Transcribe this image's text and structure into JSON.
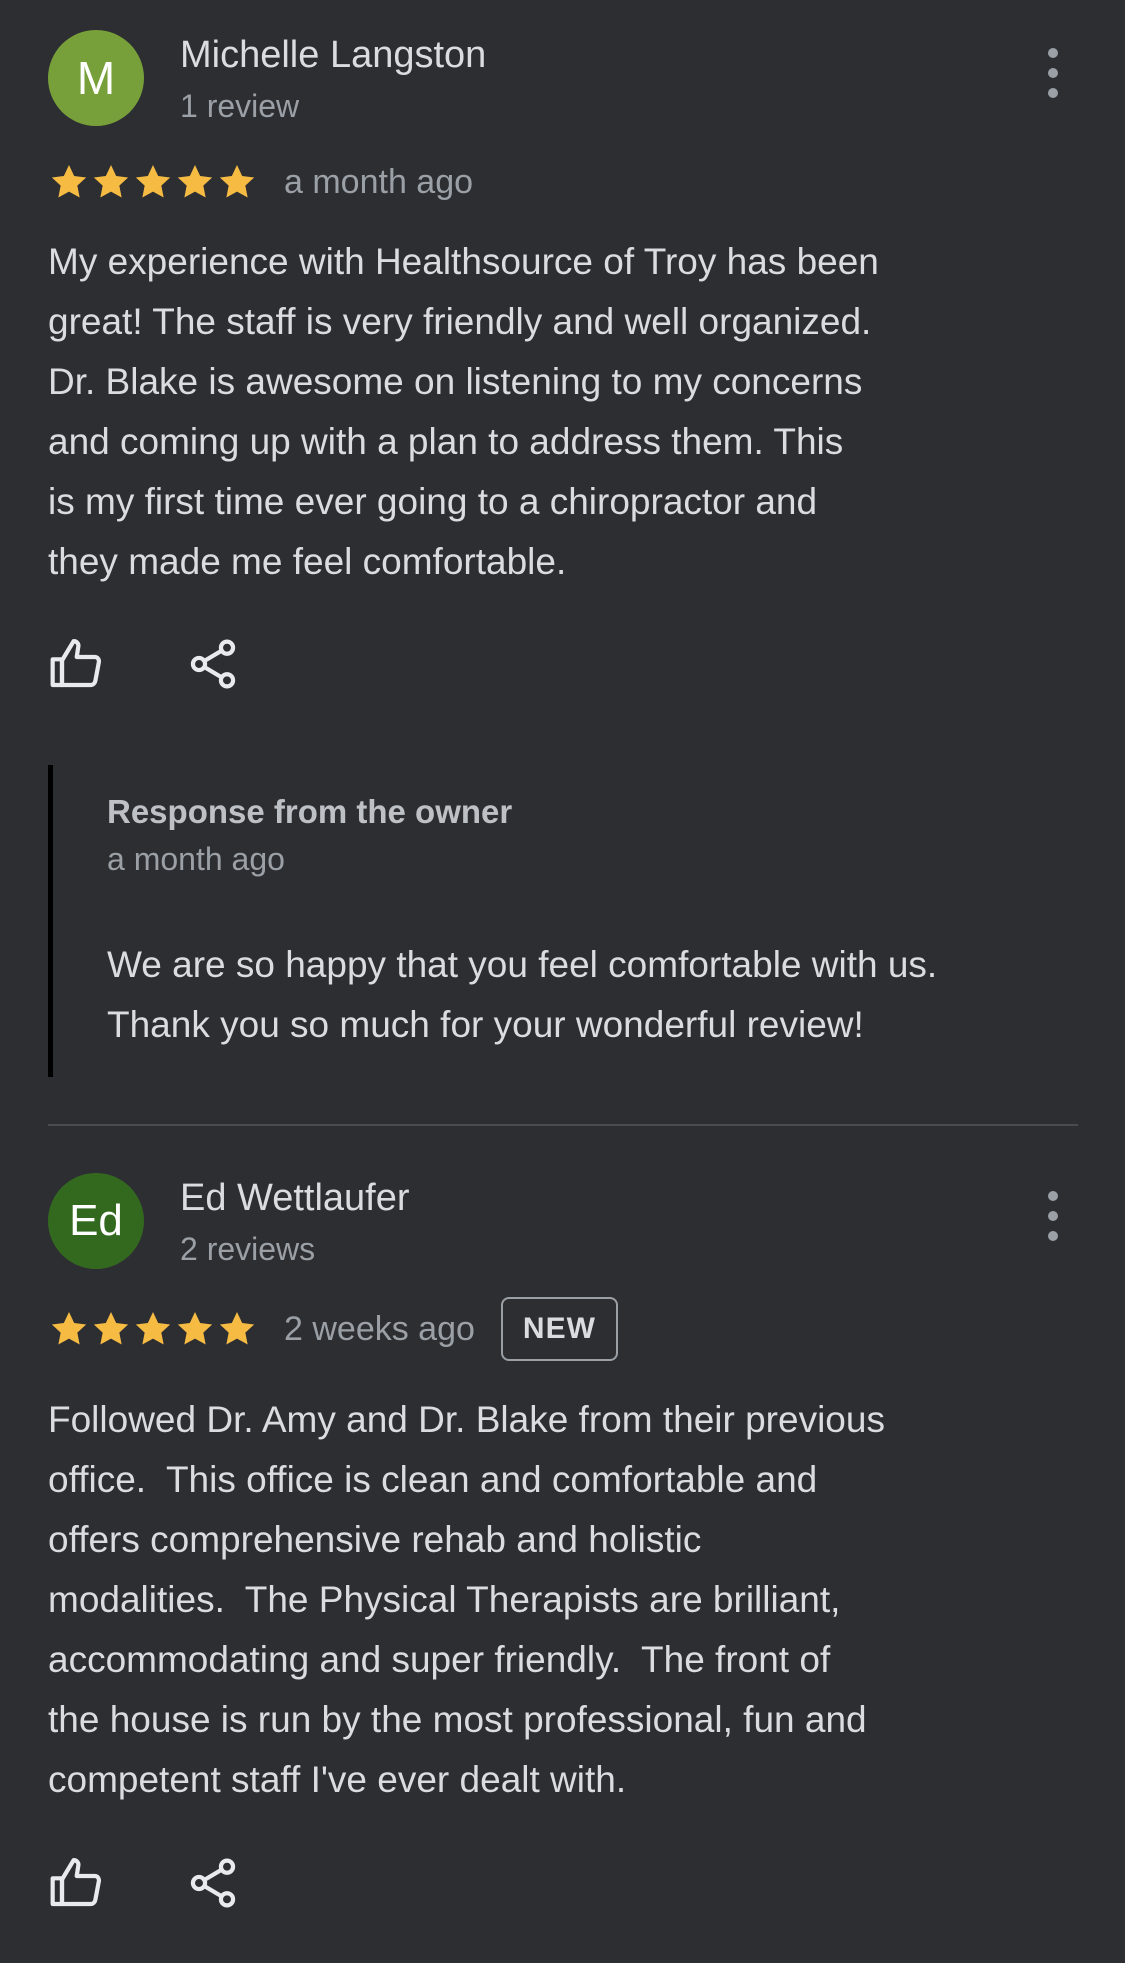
{
  "colors": {
    "background": "#2d2e32",
    "star": "#f6bb42",
    "avatar_m": "#78a03a",
    "avatar_ed": "#33691e"
  },
  "reviews": [
    {
      "avatar_letter": "M",
      "author": "Michelle Langston",
      "review_count": "1 review",
      "rating": 5,
      "time": "a month ago",
      "text_lines": [
        "My experience with Healthsource of Troy has been",
        "great! The staff is very friendly and well organized.",
        "Dr. Blake is awesome on listening to my concerns",
        "and coming up with a plan to address them. This",
        "is my first time ever going to a chiropractor and",
        "they made me feel comfortable."
      ],
      "owner_response": {
        "title": "Response from the owner",
        "time": "a month ago",
        "text_lines": [
          "We are so happy that you feel comfortable with us.",
          "Thank you so much for your wonderful review!"
        ]
      },
      "icons": [
        "thumbs-up-icon",
        "share-icon",
        "more-vert-icon"
      ]
    },
    {
      "avatar_letter": "Ed",
      "author": "Ed Wettlaufer",
      "review_count": "2 reviews",
      "rating": 5,
      "time": "2 weeks ago",
      "badge": "NEW",
      "text_lines": [
        "Followed Dr. Amy and Dr. Blake from their previous",
        "office.  This office is clean and comfortable and",
        "offers comprehensive rehab and holistic",
        "modalities.  The Physical Therapists are brilliant,",
        "accommodating and super friendly.  The front of",
        "the house is run by the most professional, fun and",
        "competent staff I've ever dealt with."
      ],
      "icons": [
        "thumbs-up-icon",
        "share-icon",
        "more-vert-icon"
      ]
    }
  ]
}
